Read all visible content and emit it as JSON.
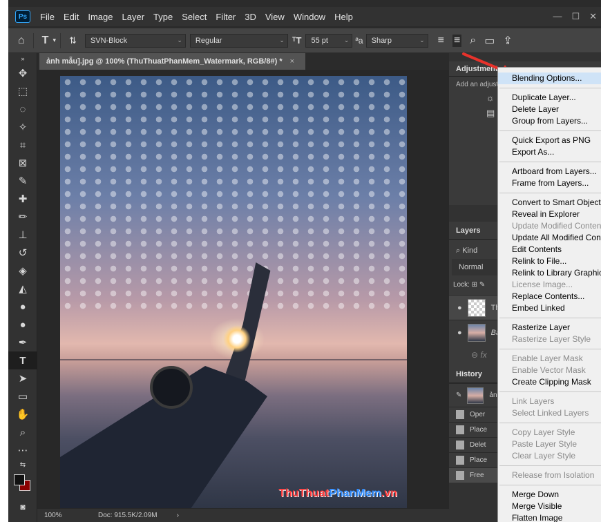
{
  "menubar": {
    "items": [
      "File",
      "Edit",
      "Image",
      "Layer",
      "Type",
      "Select",
      "Filter",
      "3D",
      "View",
      "Window",
      "Help"
    ]
  },
  "options": {
    "font_family": "SVN-Block",
    "font_style": "Regular",
    "font_size": "55 pt",
    "aa_label": "a",
    "aa_method": "Sharp"
  },
  "document": {
    "tab_title": "ảnh mẫu].jpg @ 100% (ThuThuatPhanMem_Watermark, RGB/8#) *",
    "zoom": "100%",
    "doc_info": "Doc: 915.5K/2.09M",
    "watermark_a": "ThuThuat",
    "watermark_b": "PhanMem",
    "watermark_c": ".vn"
  },
  "panels": {
    "adjustments_title": "Adjustments",
    "adjustments_hint": "Add an adjustm",
    "layers_title": "Layers",
    "kind_label": "Kind",
    "blend_mode": "Normal",
    "lock_label": "Lock:",
    "layer1_name": "Th",
    "layer2_name": "Ba",
    "history_title": "History",
    "history_items": [
      "ảnh r",
      "Oper",
      "Place",
      "Delet",
      "Place",
      "Free"
    ]
  },
  "context_menu": {
    "groups": [
      [
        {
          "label": "Blending Options...",
          "enabled": true,
          "highlight": true
        }
      ],
      [
        {
          "label": "Duplicate Layer...",
          "enabled": true
        },
        {
          "label": "Delete Layer",
          "enabled": true
        },
        {
          "label": "Group from Layers...",
          "enabled": true
        }
      ],
      [
        {
          "label": "Quick Export as PNG",
          "enabled": true
        },
        {
          "label": "Export As...",
          "enabled": true
        }
      ],
      [
        {
          "label": "Artboard from Layers...",
          "enabled": true
        },
        {
          "label": "Frame from Layers...",
          "enabled": true
        }
      ],
      [
        {
          "label": "Convert to Smart Object",
          "enabled": true
        },
        {
          "label": "Reveal in Explorer",
          "enabled": true
        },
        {
          "label": "Update Modified Content",
          "enabled": false
        },
        {
          "label": "Update All Modified Content",
          "enabled": true
        },
        {
          "label": "Edit Contents",
          "enabled": true
        },
        {
          "label": "Relink to File...",
          "enabled": true
        },
        {
          "label": "Relink to Library Graphic...",
          "enabled": true
        },
        {
          "label": "License Image...",
          "enabled": false
        },
        {
          "label": "Replace Contents...",
          "enabled": true
        },
        {
          "label": "Embed Linked",
          "enabled": true
        }
      ],
      [
        {
          "label": "Rasterize Layer",
          "enabled": true
        },
        {
          "label": "Rasterize Layer Style",
          "enabled": false
        }
      ],
      [
        {
          "label": "Enable Layer Mask",
          "enabled": false
        },
        {
          "label": "Enable Vector Mask",
          "enabled": false
        },
        {
          "label": "Create Clipping Mask",
          "enabled": true
        }
      ],
      [
        {
          "label": "Link Layers",
          "enabled": false
        },
        {
          "label": "Select Linked Layers",
          "enabled": false
        }
      ],
      [
        {
          "label": "Copy Layer Style",
          "enabled": false
        },
        {
          "label": "Paste Layer Style",
          "enabled": false
        },
        {
          "label": "Clear Layer Style",
          "enabled": false
        }
      ],
      [
        {
          "label": "Release from Isolation",
          "enabled": false
        }
      ],
      [
        {
          "label": "Merge Down",
          "enabled": true
        },
        {
          "label": "Merge Visible",
          "enabled": true
        },
        {
          "label": "Flatten Image",
          "enabled": true
        }
      ]
    ]
  },
  "colors": {
    "accent_arrow": "#e8322b",
    "foreground": "#111111",
    "background": "#8b0000"
  }
}
